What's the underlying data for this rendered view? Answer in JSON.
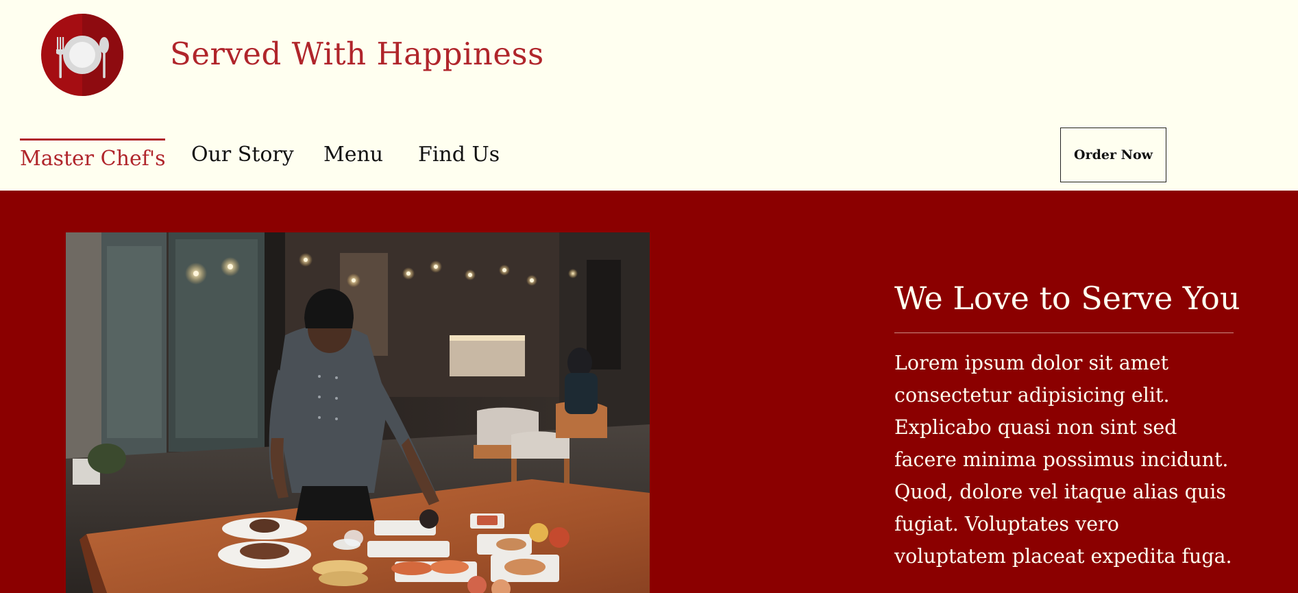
{
  "brand": {
    "title": "Served With Happiness",
    "logo_icon": "plate-fork-spoon-icon",
    "logo_color": "#a50d12"
  },
  "nav": {
    "items": [
      {
        "label": "Master Chef's",
        "active": true
      },
      {
        "label": "Our Story",
        "active": false
      },
      {
        "label": "Menu",
        "active": false
      },
      {
        "label": "Find Us",
        "active": false
      }
    ],
    "order_button_label": "Order Now"
  },
  "hero": {
    "heading": "We Love to Serve You",
    "body": "Lorem ipsum dolor sit amet consectetur adipisicing elit. Explicabo quasi non sint sed facere minima possimus incidunt. Quod, dolore vel itaque alias quis fugiat. Voluptates vero voluptatem placeat expedita fuga.",
    "image_subject": "chef-plating-dishes-photo"
  },
  "colors": {
    "accent": "#b0252b",
    "hero_background": "#8b0000",
    "page_background": "#fffff0",
    "text_dark": "#111111",
    "text_light": "#fffff0"
  }
}
